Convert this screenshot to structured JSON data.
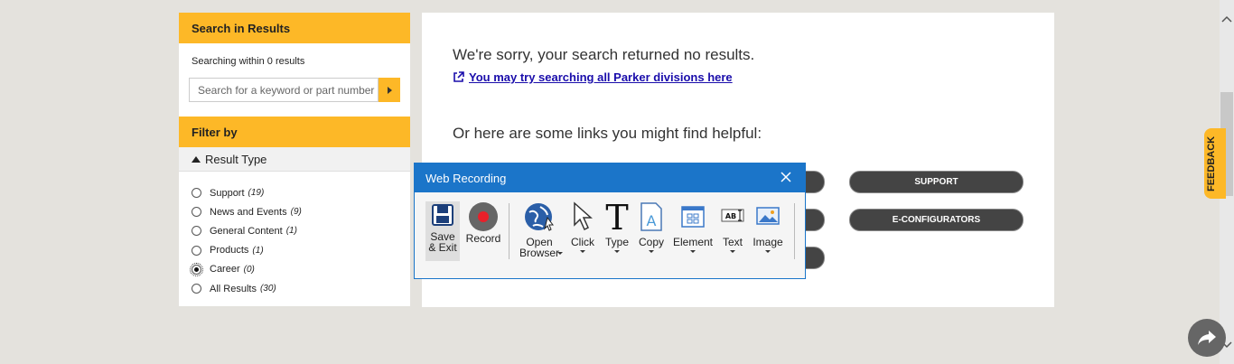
{
  "sidebar": {
    "search_header": "Search in Results",
    "searching_within": "Searching within 0 results",
    "search_placeholder": "Search for a keyword or part number",
    "filter_header": "Filter by",
    "result_type_label": "Result Type",
    "options": [
      {
        "label": "Support",
        "count": "(19)",
        "selected": false
      },
      {
        "label": "News and Events",
        "count": "(9)",
        "selected": false
      },
      {
        "label": "General Content",
        "count": "(1)",
        "selected": false
      },
      {
        "label": "Products",
        "count": "(1)",
        "selected": false
      },
      {
        "label": "Career",
        "count": "(0)",
        "selected": true
      },
      {
        "label": "All Results",
        "count": "(30)",
        "selected": false
      }
    ]
  },
  "main": {
    "sorry_text": "We're sorry, your search returned no results.",
    "all_divisions_link": "You may try searching all Parker divisions here",
    "helpful_text": "Or here are some links you might find helpful:",
    "buttons": {
      "support": "SUPPORT",
      "econfigurators": "E-CONFIGURATORS"
    }
  },
  "dialog": {
    "title": "Web Recording",
    "tools": {
      "save": [
        "Save",
        "& Exit"
      ],
      "record": "Record",
      "open_browser": [
        "Open",
        "Browser"
      ],
      "click": "Click",
      "type": "Type",
      "copy": "Copy",
      "element": "Element",
      "text": "Text",
      "image": "Image"
    }
  },
  "feedback_label": "FEEDBACK",
  "colors": {
    "accent": "#fdb827",
    "dialog_blue": "#1b75c9",
    "link": "#1a0dab"
  }
}
